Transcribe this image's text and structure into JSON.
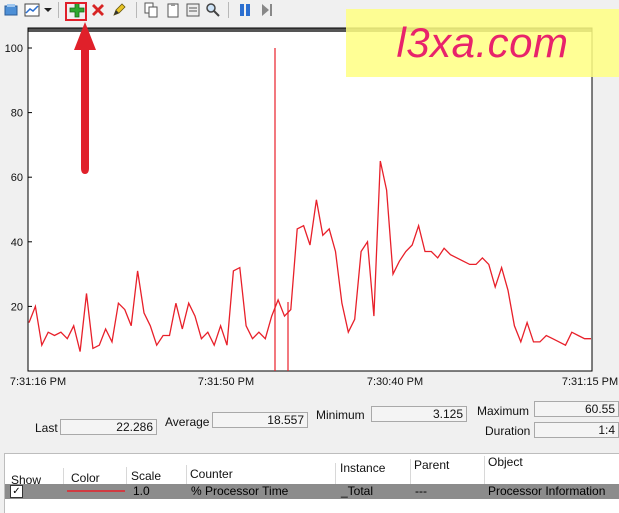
{
  "watermark": "l3xa.com",
  "toolbar": {
    "icons": [
      "view-current-activity-icon",
      "change-graph-type-icon",
      "dropdown-arrow-icon",
      "add-counter-icon",
      "delete-counter-icon",
      "highlight-icon",
      "copy-properties-icon",
      "paste-counter-list-icon",
      "properties-icon",
      "zoom-icon",
      "freeze-display-icon",
      "update-data-icon"
    ]
  },
  "graph": {
    "y_ticks": [
      "100",
      "80",
      "60",
      "40",
      "20"
    ],
    "x_ticks": [
      "7:31:16 PM",
      "7:31:50 PM",
      "7:30:40 PM",
      "7:31:15 PM"
    ],
    "line_color": "#e8202a"
  },
  "chart_data": {
    "type": "line",
    "ylim": [
      0,
      100
    ],
    "x": [
      "7:31:16 PM",
      "7:31:50 PM",
      "7:30:40 PM",
      "7:31:15 PM"
    ],
    "series": [
      {
        "name": "% Processor Time",
        "values": [
          15,
          20,
          8,
          12,
          11,
          12,
          10,
          14,
          6,
          24,
          7,
          8,
          13,
          9,
          21,
          19,
          14,
          31,
          18,
          14,
          8,
          11,
          11,
          21,
          13,
          21,
          17,
          10,
          12,
          8,
          14,
          8,
          31,
          32,
          14,
          10,
          12,
          10,
          17,
          22,
          17,
          19,
          44,
          45,
          39,
          53,
          42,
          44,
          37,
          21,
          12,
          16,
          37,
          40,
          17,
          65,
          56,
          30,
          34,
          37,
          39,
          45,
          37,
          37,
          35,
          38,
          36,
          35,
          34,
          33,
          33,
          35,
          33,
          26,
          32,
          25,
          14,
          9,
          15,
          9,
          9,
          11,
          10,
          9,
          8,
          12,
          11,
          10,
          10
        ]
      }
    ]
  },
  "stats": {
    "last_label": "Last",
    "last_value": "22.286",
    "average_label": "Average",
    "average_value": "18.557",
    "minimum_label": "Minimum",
    "minimum_value": "3.125",
    "maximum_label": "Maximum",
    "maximum_value": "60.55",
    "duration_label": "Duration",
    "duration_value": "1:4"
  },
  "table": {
    "headers": {
      "show": "Show",
      "color": "Color",
      "scale": "Scale",
      "counter": "Counter",
      "instance": "Instance",
      "parent": "Parent",
      "object": "Object"
    },
    "rows": [
      {
        "show": "✓",
        "scale": "1.0",
        "counter": "% Processor Time",
        "instance": "_Total",
        "parent": "---",
        "object": "Processor Information"
      }
    ]
  }
}
